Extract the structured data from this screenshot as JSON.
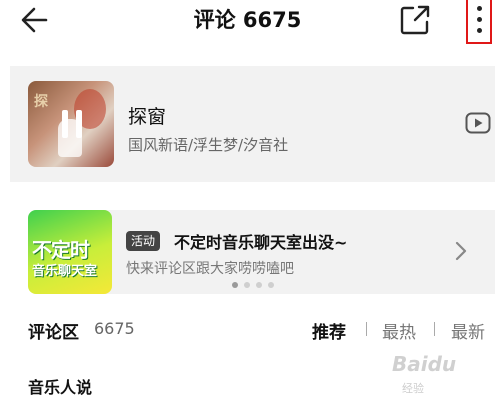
{
  "header": {
    "title": "评论 6675",
    "icons": {
      "back": "arrow-left-icon",
      "share": "share-icon",
      "more": "more-vertical-icon"
    },
    "highlight_color": "#e01818"
  },
  "song": {
    "name": "探窗",
    "artist": "国风新语/浮生梦/汐音社",
    "cover_text": "探",
    "state": "playing"
  },
  "banner": {
    "image_line1": "不定时",
    "image_line2": "音乐聊天室",
    "badge": "活动",
    "title": "不定时音乐聊天室出没~",
    "subtitle": "快来评论区跟大家唠唠嗑吧",
    "page_count": 4,
    "active_page": 1
  },
  "comments": {
    "label": "评论区",
    "count": "6675",
    "sort_options": [
      "推荐",
      "最热",
      "最新"
    ],
    "active_sort": "推荐"
  },
  "section": {
    "title": "音乐人说"
  },
  "watermark": {
    "text": "Baidu",
    "sub": "经验"
  }
}
